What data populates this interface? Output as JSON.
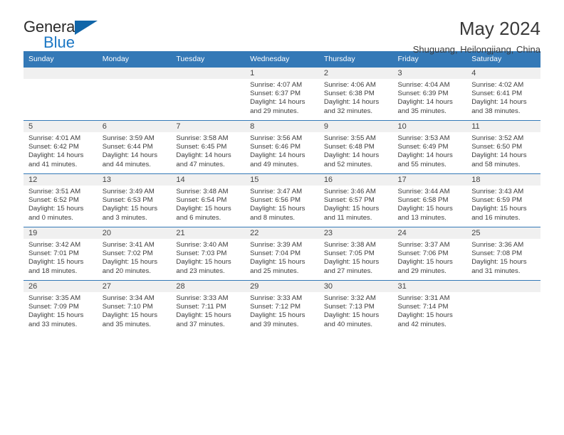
{
  "brand": {
    "name_dark": "General",
    "name_blue": "Blue",
    "accent_color": "#1b77c4",
    "header_color": "#3479b7"
  },
  "header": {
    "title": "May 2024",
    "subtitle": "Shuguang, Heilongjiang, China"
  },
  "weekdays": [
    "Sunday",
    "Monday",
    "Tuesday",
    "Wednesday",
    "Thursday",
    "Friday",
    "Saturday"
  ],
  "labels": {
    "sunrise": "Sunrise:",
    "sunset": "Sunset:",
    "daylight": "Daylight:"
  },
  "weeks": [
    [
      {
        "day": "",
        "sunrise": "",
        "sunset": "",
        "daylight_1": "",
        "daylight_2": ""
      },
      {
        "day": "",
        "sunrise": "",
        "sunset": "",
        "daylight_1": "",
        "daylight_2": ""
      },
      {
        "day": "",
        "sunrise": "",
        "sunset": "",
        "daylight_1": "",
        "daylight_2": ""
      },
      {
        "day": "1",
        "sunrise": "Sunrise: 4:07 AM",
        "sunset": "Sunset: 6:37 PM",
        "daylight_1": "Daylight: 14 hours",
        "daylight_2": "and 29 minutes."
      },
      {
        "day": "2",
        "sunrise": "Sunrise: 4:06 AM",
        "sunset": "Sunset: 6:38 PM",
        "daylight_1": "Daylight: 14 hours",
        "daylight_2": "and 32 minutes."
      },
      {
        "day": "3",
        "sunrise": "Sunrise: 4:04 AM",
        "sunset": "Sunset: 6:39 PM",
        "daylight_1": "Daylight: 14 hours",
        "daylight_2": "and 35 minutes."
      },
      {
        "day": "4",
        "sunrise": "Sunrise: 4:02 AM",
        "sunset": "Sunset: 6:41 PM",
        "daylight_1": "Daylight: 14 hours",
        "daylight_2": "and 38 minutes."
      }
    ],
    [
      {
        "day": "5",
        "sunrise": "Sunrise: 4:01 AM",
        "sunset": "Sunset: 6:42 PM",
        "daylight_1": "Daylight: 14 hours",
        "daylight_2": "and 41 minutes."
      },
      {
        "day": "6",
        "sunrise": "Sunrise: 3:59 AM",
        "sunset": "Sunset: 6:44 PM",
        "daylight_1": "Daylight: 14 hours",
        "daylight_2": "and 44 minutes."
      },
      {
        "day": "7",
        "sunrise": "Sunrise: 3:58 AM",
        "sunset": "Sunset: 6:45 PM",
        "daylight_1": "Daylight: 14 hours",
        "daylight_2": "and 47 minutes."
      },
      {
        "day": "8",
        "sunrise": "Sunrise: 3:56 AM",
        "sunset": "Sunset: 6:46 PM",
        "daylight_1": "Daylight: 14 hours",
        "daylight_2": "and 49 minutes."
      },
      {
        "day": "9",
        "sunrise": "Sunrise: 3:55 AM",
        "sunset": "Sunset: 6:48 PM",
        "daylight_1": "Daylight: 14 hours",
        "daylight_2": "and 52 minutes."
      },
      {
        "day": "10",
        "sunrise": "Sunrise: 3:53 AM",
        "sunset": "Sunset: 6:49 PM",
        "daylight_1": "Daylight: 14 hours",
        "daylight_2": "and 55 minutes."
      },
      {
        "day": "11",
        "sunrise": "Sunrise: 3:52 AM",
        "sunset": "Sunset: 6:50 PM",
        "daylight_1": "Daylight: 14 hours",
        "daylight_2": "and 58 minutes."
      }
    ],
    [
      {
        "day": "12",
        "sunrise": "Sunrise: 3:51 AM",
        "sunset": "Sunset: 6:52 PM",
        "daylight_1": "Daylight: 15 hours",
        "daylight_2": "and 0 minutes."
      },
      {
        "day": "13",
        "sunrise": "Sunrise: 3:49 AM",
        "sunset": "Sunset: 6:53 PM",
        "daylight_1": "Daylight: 15 hours",
        "daylight_2": "and 3 minutes."
      },
      {
        "day": "14",
        "sunrise": "Sunrise: 3:48 AM",
        "sunset": "Sunset: 6:54 PM",
        "daylight_1": "Daylight: 15 hours",
        "daylight_2": "and 6 minutes."
      },
      {
        "day": "15",
        "sunrise": "Sunrise: 3:47 AM",
        "sunset": "Sunset: 6:56 PM",
        "daylight_1": "Daylight: 15 hours",
        "daylight_2": "and 8 minutes."
      },
      {
        "day": "16",
        "sunrise": "Sunrise: 3:46 AM",
        "sunset": "Sunset: 6:57 PM",
        "daylight_1": "Daylight: 15 hours",
        "daylight_2": "and 11 minutes."
      },
      {
        "day": "17",
        "sunrise": "Sunrise: 3:44 AM",
        "sunset": "Sunset: 6:58 PM",
        "daylight_1": "Daylight: 15 hours",
        "daylight_2": "and 13 minutes."
      },
      {
        "day": "18",
        "sunrise": "Sunrise: 3:43 AM",
        "sunset": "Sunset: 6:59 PM",
        "daylight_1": "Daylight: 15 hours",
        "daylight_2": "and 16 minutes."
      }
    ],
    [
      {
        "day": "19",
        "sunrise": "Sunrise: 3:42 AM",
        "sunset": "Sunset: 7:01 PM",
        "daylight_1": "Daylight: 15 hours",
        "daylight_2": "and 18 minutes."
      },
      {
        "day": "20",
        "sunrise": "Sunrise: 3:41 AM",
        "sunset": "Sunset: 7:02 PM",
        "daylight_1": "Daylight: 15 hours",
        "daylight_2": "and 20 minutes."
      },
      {
        "day": "21",
        "sunrise": "Sunrise: 3:40 AM",
        "sunset": "Sunset: 7:03 PM",
        "daylight_1": "Daylight: 15 hours",
        "daylight_2": "and 23 minutes."
      },
      {
        "day": "22",
        "sunrise": "Sunrise: 3:39 AM",
        "sunset": "Sunset: 7:04 PM",
        "daylight_1": "Daylight: 15 hours",
        "daylight_2": "and 25 minutes."
      },
      {
        "day": "23",
        "sunrise": "Sunrise: 3:38 AM",
        "sunset": "Sunset: 7:05 PM",
        "daylight_1": "Daylight: 15 hours",
        "daylight_2": "and 27 minutes."
      },
      {
        "day": "24",
        "sunrise": "Sunrise: 3:37 AM",
        "sunset": "Sunset: 7:06 PM",
        "daylight_1": "Daylight: 15 hours",
        "daylight_2": "and 29 minutes."
      },
      {
        "day": "25",
        "sunrise": "Sunrise: 3:36 AM",
        "sunset": "Sunset: 7:08 PM",
        "daylight_1": "Daylight: 15 hours",
        "daylight_2": "and 31 minutes."
      }
    ],
    [
      {
        "day": "26",
        "sunrise": "Sunrise: 3:35 AM",
        "sunset": "Sunset: 7:09 PM",
        "daylight_1": "Daylight: 15 hours",
        "daylight_2": "and 33 minutes."
      },
      {
        "day": "27",
        "sunrise": "Sunrise: 3:34 AM",
        "sunset": "Sunset: 7:10 PM",
        "daylight_1": "Daylight: 15 hours",
        "daylight_2": "and 35 minutes."
      },
      {
        "day": "28",
        "sunrise": "Sunrise: 3:33 AM",
        "sunset": "Sunset: 7:11 PM",
        "daylight_1": "Daylight: 15 hours",
        "daylight_2": "and 37 minutes."
      },
      {
        "day": "29",
        "sunrise": "Sunrise: 3:33 AM",
        "sunset": "Sunset: 7:12 PM",
        "daylight_1": "Daylight: 15 hours",
        "daylight_2": "and 39 minutes."
      },
      {
        "day": "30",
        "sunrise": "Sunrise: 3:32 AM",
        "sunset": "Sunset: 7:13 PM",
        "daylight_1": "Daylight: 15 hours",
        "daylight_2": "and 40 minutes."
      },
      {
        "day": "31",
        "sunrise": "Sunrise: 3:31 AM",
        "sunset": "Sunset: 7:14 PM",
        "daylight_1": "Daylight: 15 hours",
        "daylight_2": "and 42 minutes."
      },
      {
        "day": "",
        "sunrise": "",
        "sunset": "",
        "daylight_1": "",
        "daylight_2": ""
      }
    ]
  ]
}
